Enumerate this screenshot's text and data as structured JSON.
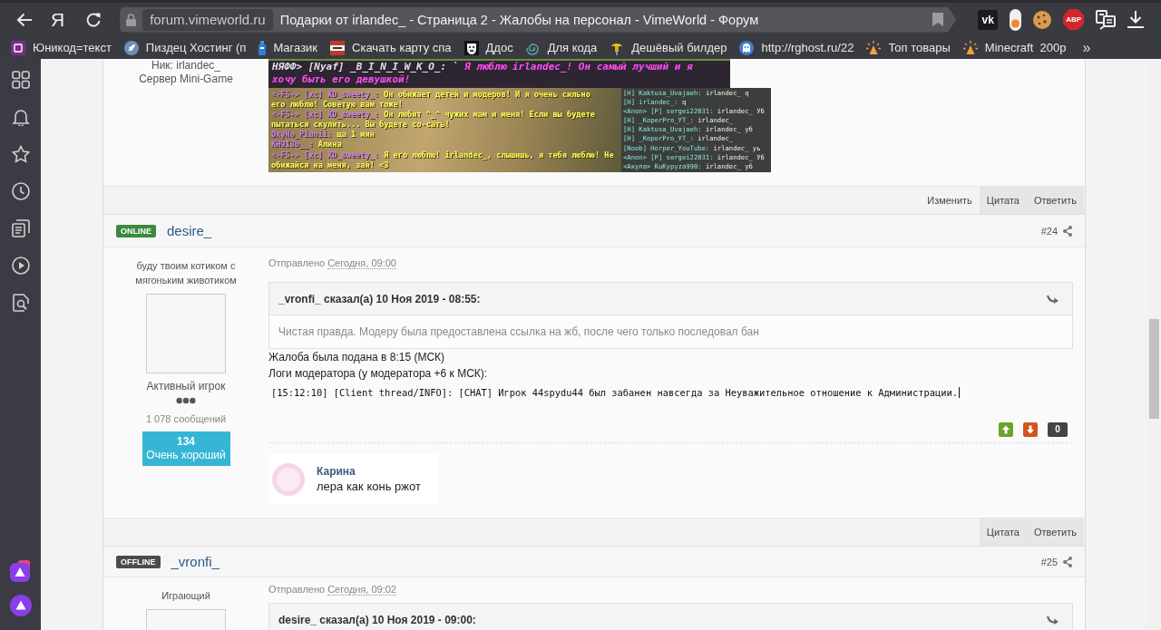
{
  "browser": {
    "logo": "Я",
    "domain": "forum.vimeworld.ru",
    "title": "Подарки от irlandec_ - Страница 2 - Жалобы на персонал - VimeWorld - Форум",
    "extensions": [
      {
        "kind": "vk",
        "label": "vk"
      },
      {
        "kind": "toggle"
      },
      {
        "kind": "cookie"
      },
      {
        "kind": "abp",
        "label": "ABP"
      },
      {
        "kind": "translate"
      },
      {
        "kind": "download"
      }
    ]
  },
  "bookmarks": {
    "items": [
      {
        "kind": "tile",
        "label": "Юникод=текст"
      },
      {
        "kind": "rocket",
        "label": "Пиздец Хостинг (п"
      },
      {
        "kind": "bottle",
        "label": "Магазик"
      },
      {
        "kind": "block",
        "label": "Скачать карту спа"
      },
      {
        "kind": "mask",
        "label": "Ддос"
      },
      {
        "kind": "swirl",
        "label": "Для кода"
      },
      {
        "kind": "tap",
        "label": "Дешёвый билдер"
      },
      {
        "kind": "ghost",
        "label": "http://rghost.ru/22"
      },
      {
        "kind": "spark",
        "label": "Топ товары"
      },
      {
        "kind": "spark",
        "label": "Minecraft  200р"
      }
    ],
    "more": "»"
  },
  "top_post": {
    "user_lines": [
      "Ник: irlandec_",
      "Сервер Mini-Game"
    ],
    "screenshots": [
      {
        "kind": "banner",
        "lines": [
          {
            "who": "НЯФФ> [Nyaf] _B_I_N_I_W_K_O_: `",
            "text": "Я люблю irlandec_! Он самый лучший и я"
          },
          {
            "text": "хочу быть его девушкой!"
          }
        ]
      },
      {
        "kind": "main",
        "lines": [
          {
            "who": "<-F5-> [xc] XD_sweety_:",
            "text": "Он обижает детей и модеров! И я очень сильно"
          },
          {
            "text": "его люблю! Советую вам тоже!"
          },
          {
            "who": "<-F5-> [xc] XD_sweety_:",
            "text": "Он любит ^_^ чужих мам и меня! Если вы будете"
          },
          {
            "text": "пытаться скулить... Вы будете со-сать!"
          },
          {
            "who": "ОкуНо_Pianii:",
            "text": "ща 1 мин"
          },
          {
            "who": "KH9I3b__:",
            "text": "Алина"
          },
          {
            "who": "<-F5-> [xc] XD_sweety_:",
            "text": "Я его люблю! irlandec_, слышишь, я тебя люблю! Не"
          },
          {
            "text": "обижайся на меня, зай! <3"
          }
        ]
      },
      {
        "kind": "side",
        "lines": [
          {
            "who": "[H] Kaktusa_Uvajaeh:",
            "text": "irlandec_ q"
          },
          {
            "who": "[H] irlandec_:",
            "text": "q"
          },
          {
            "who": "<Anon> [P] sergei22031:",
            "text": "irlandec_ Уб"
          },
          {
            "who": "[H] _KoperPro_YT_:",
            "text": "irlandec_"
          },
          {
            "who": "[H] Kaktusa_Uvajaeh:",
            "text": "irlandec_ уб"
          },
          {
            "who": "[H] _KoperPro_YT_:",
            "text": "irlandec_"
          },
          {
            "who": "[Noob] Horper_YouTube:",
            "text": "irlandec_ уь"
          },
          {
            "who": "<Anon> [P] sergei22031:",
            "text": "irlandec_ Уб"
          },
          {
            "who": "<Акула> KuKypyza990:",
            "text": "irlandec_ уб"
          }
        ]
      }
    ],
    "actions": [
      {
        "kind": "plain",
        "label": "Изменить"
      },
      {
        "kind": "filled",
        "label": "Цитата"
      },
      {
        "kind": "filled",
        "label": "Ответить"
      }
    ]
  },
  "posts": [
    {
      "status": {
        "label": "ONLINE",
        "online": true
      },
      "author": "desire_",
      "number": "#24",
      "user_title": "буду твоим котиком с мягоньким животиком",
      "rank": "Активный игрок",
      "post_count": "1 078 сообщений",
      "reputation": {
        "score": "134",
        "label": "Очень хороший"
      },
      "posted_label": "Отправлено",
      "posted_time": "Сегодня, 09:00",
      "quote": {
        "header": "_vronfi_ сказал(а) 10 Ноя 2019 - 08:55:",
        "text": "Чистая правда. Модеру была предоставлена ссылка на жб, после чего только последовал бан"
      },
      "paragraphs": [
        "Жалоба была подана в 8:15 (МСК)",
        "Логи модератора (у модератора +6 к МСК):"
      ],
      "log_lines": [
        "[15:12:10] [Client thread/INFO]: [CHAT] Игрок 44spydu44 был забанен навсегда за Неуважительное отношение к Администрации."
      ],
      "votes": {
        "count": "0"
      },
      "signature": {
        "name": "Карина",
        "text": "лера как конь ржот"
      },
      "actions": [
        {
          "kind": "filled",
          "label": "Цитата"
        },
        {
          "kind": "filled",
          "label": "Ответить"
        }
      ]
    },
    {
      "status": {
        "label": "OFFLINE",
        "online": false
      },
      "author": "_vronfi_",
      "number": "#25",
      "user_title": "Играющий",
      "posted_label": "Отправлено",
      "posted_time": "Сегодня, 09:02",
      "quote": {
        "header": "desire_ сказал(а) 10 Ноя 2019 - 09:00:"
      }
    }
  ]
}
